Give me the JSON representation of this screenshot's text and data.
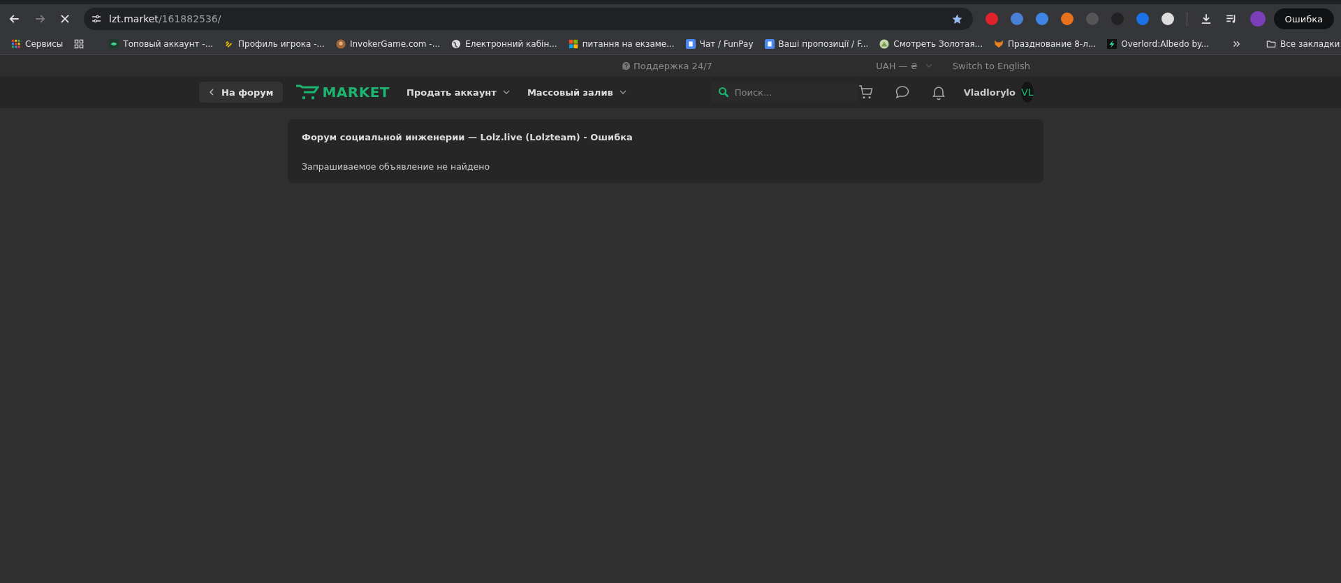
{
  "browser": {
    "loading": true,
    "address": {
      "host": "lzt.market",
      "path": "/161882536/"
    },
    "profile_button": "Ошибка",
    "bookmarks": [
      {
        "label": "Сервисы",
        "kind": "apps"
      },
      {
        "label": "Топовый аккаунт -...",
        "kind": "eye"
      },
      {
        "label": "Профиль игрока -...",
        "kind": "stripes"
      },
      {
        "label": "InvokerGame.com -...",
        "kind": "avatar"
      },
      {
        "label": "Електронний кабін...",
        "kind": "globe"
      },
      {
        "label": "питання на екзаме...",
        "kind": "tiles"
      },
      {
        "label": "Чат / FunPay",
        "kind": "letter"
      },
      {
        "label": "Ваші пропозиції / F...",
        "kind": "letter"
      },
      {
        "label": "Смотреть Золотая...",
        "kind": "tent"
      },
      {
        "label": "Празднование 8-л...",
        "kind": "fox"
      },
      {
        "label": "Overlord:Albedo by...",
        "kind": "bolt"
      }
    ],
    "all_bookmarks": "Все закладки"
  },
  "site": {
    "support": "Поддержка 24/7",
    "currency": "UAH — ₴",
    "language": "Switch to English",
    "back_button": "На форум",
    "logo": "MARKET",
    "nav": [
      {
        "label": "Продать аккаунт"
      },
      {
        "label": "Массовый залив"
      }
    ],
    "search": {
      "placeholder": "Поиск..."
    },
    "user": {
      "name": "Vladlorylo",
      "initials": "VL"
    },
    "error_card": {
      "title": "Форум социальной инженерии — Lolz.live (Lolzteam) - Ошибка",
      "message": "Запрашиваемое объявление не найдено"
    }
  }
}
